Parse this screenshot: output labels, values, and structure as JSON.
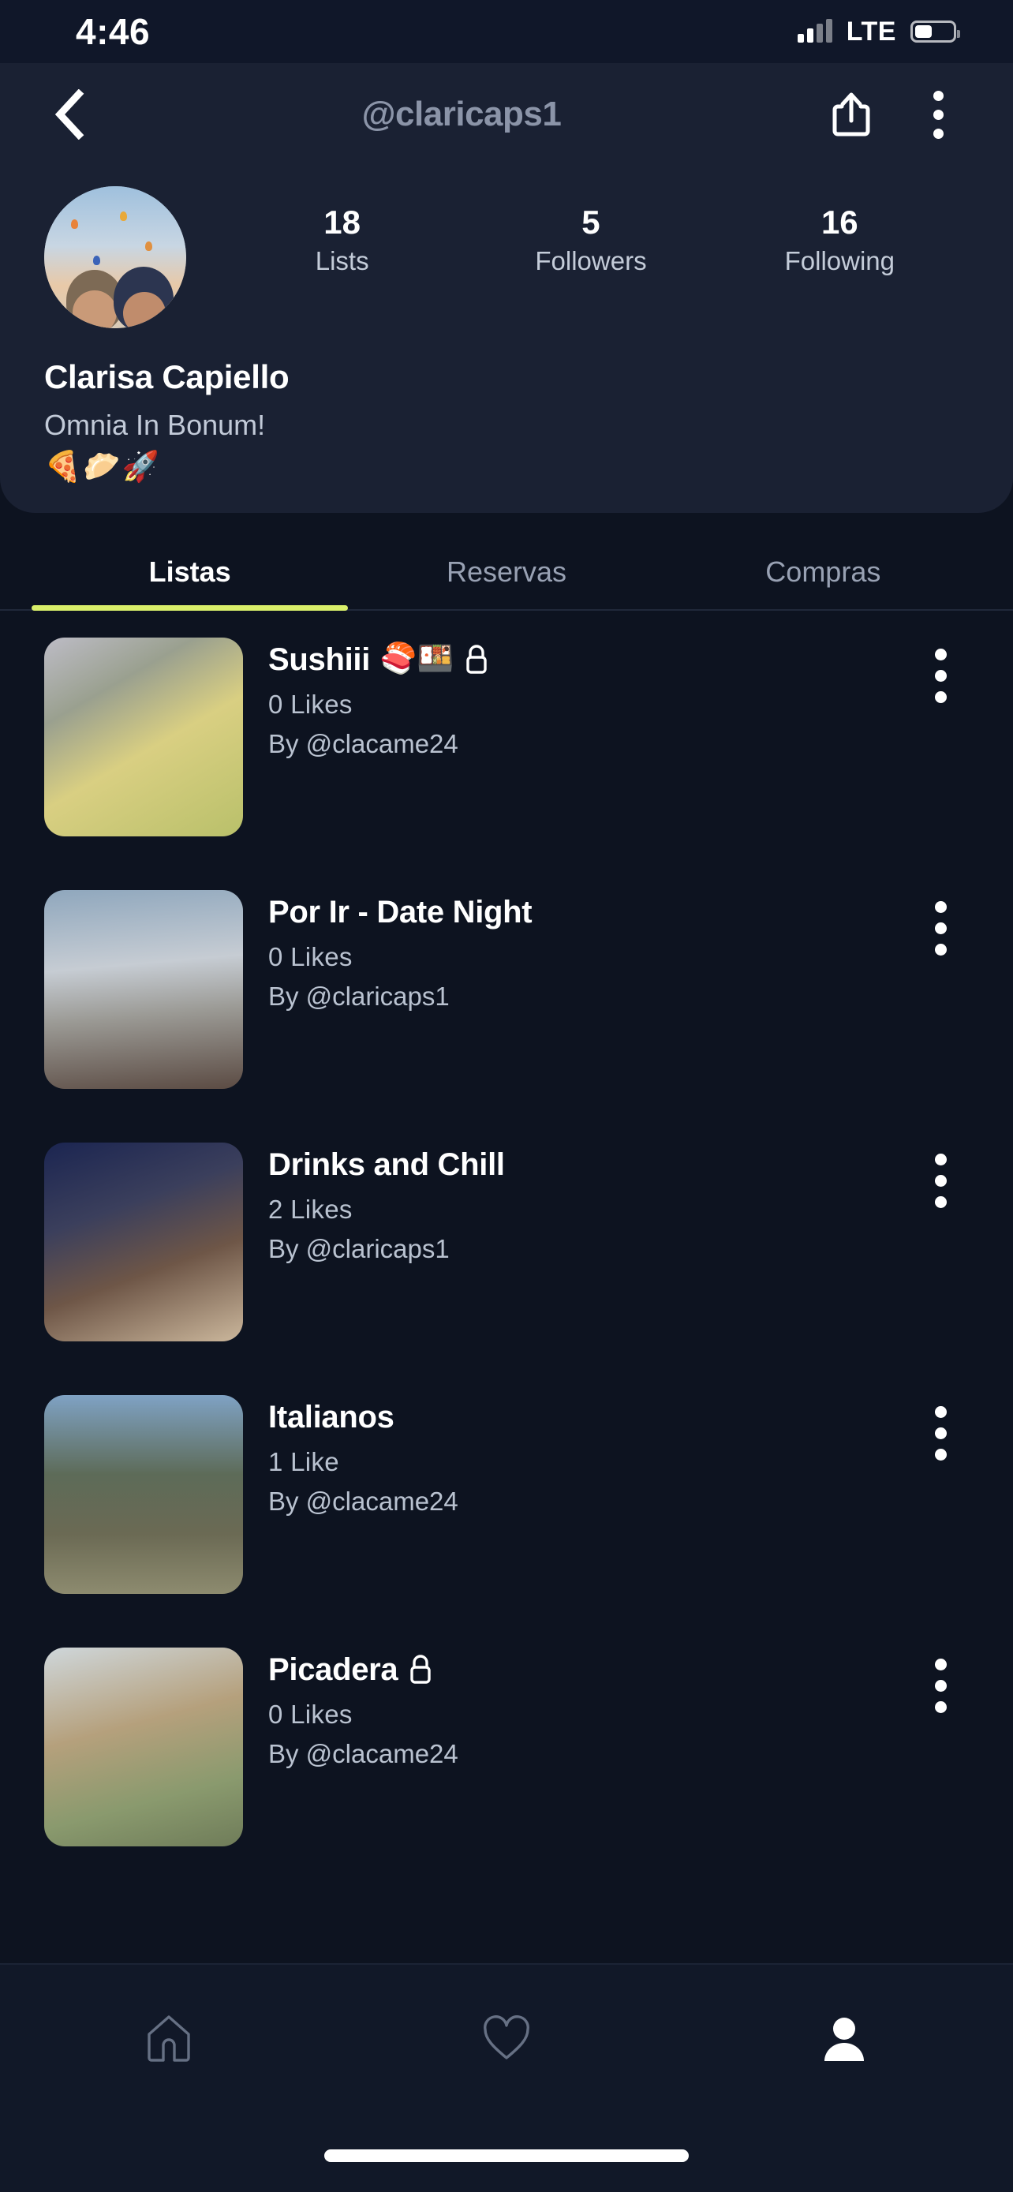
{
  "status_bar": {
    "time": "4:46",
    "carrier_tech": "LTE",
    "signal_icon": "cellular-signal-icon",
    "battery_icon": "battery-icon"
  },
  "header": {
    "back_icon": "chevron-left-icon",
    "handle": "@claricaps1",
    "share_icon": "share-icon",
    "more_icon": "kebab-menu-icon"
  },
  "profile": {
    "avatar_name": "profile-avatar",
    "display_name": "Clarisa Capiello",
    "bio": "Omnia In Bonum!",
    "bio_emoji": "🍕🥟🚀",
    "stats": [
      {
        "value": "18",
        "label": "Lists"
      },
      {
        "value": "5",
        "label": "Followers"
      },
      {
        "value": "16",
        "label": "Following"
      }
    ]
  },
  "tabs": {
    "active_index": 0,
    "accent_color": "#d9ef6a",
    "items": [
      {
        "label": "Listas"
      },
      {
        "label": "Reservas"
      },
      {
        "label": "Compras"
      }
    ]
  },
  "lists": [
    {
      "title": "Sushiii",
      "emoji": "🍣🍱",
      "private": true,
      "likes": "0  Likes",
      "by": "By @clacame24",
      "thumb_class": "t-sushi",
      "thumb_name": "list-thumbnail-sushiii"
    },
    {
      "title": "Por Ir - Date Night",
      "emoji": "",
      "private": false,
      "likes": "0  Likes",
      "by": "By @claricaps1",
      "thumb_class": "t-date",
      "thumb_name": "list-thumbnail-por-ir-date-night"
    },
    {
      "title": "Drinks and Chill",
      "emoji": "",
      "private": false,
      "likes": "2  Likes",
      "by": "By @claricaps1",
      "thumb_class": "t-drinks",
      "thumb_name": "list-thumbnail-drinks-and-chill"
    },
    {
      "title": "Italianos",
      "emoji": "",
      "private": false,
      "likes": "1  Like",
      "by": "By @clacame24",
      "thumb_class": "t-ital",
      "thumb_name": "list-thumbnail-italianos"
    },
    {
      "title": "Picadera",
      "emoji": "",
      "private": true,
      "likes": "0  Likes",
      "by": "By @clacame24",
      "thumb_class": "t-pica",
      "thumb_name": "list-thumbnail-picadera"
    }
  ],
  "bottom_nav": {
    "items": [
      {
        "icon": "home-icon",
        "active": false
      },
      {
        "icon": "heart-icon",
        "active": false
      },
      {
        "icon": "person-icon",
        "active": true
      }
    ]
  },
  "colors": {
    "page_background": "#0d1320",
    "card_background": "#1a2133",
    "status_background": "#101729",
    "accent": "#d9ef6a",
    "text_primary": "#ffffff",
    "text_secondary": "#b9c2d0"
  }
}
